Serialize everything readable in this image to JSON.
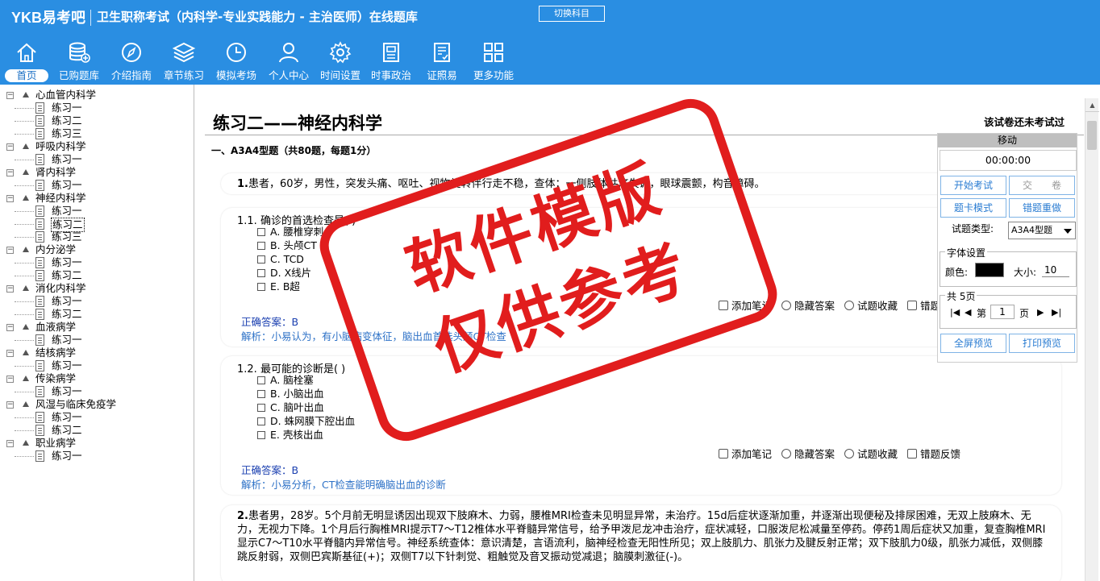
{
  "header": {
    "logo": "YKB易考吧",
    "app_title": "卫生职称考试（内科学-专业实践能力 - 主治医师）在线题库",
    "switch_label": "切换科目"
  },
  "nav": [
    {
      "label": "首页",
      "icon": "home-icon",
      "active": true
    },
    {
      "label": "已购题库",
      "icon": "database-icon"
    },
    {
      "label": "介绍指南",
      "icon": "compass-icon"
    },
    {
      "label": "章节练习",
      "icon": "layers-icon"
    },
    {
      "label": "模拟考场",
      "icon": "clock-icon"
    },
    {
      "label": "个人中心",
      "icon": "user-icon"
    },
    {
      "label": "时间设置",
      "icon": "gear-icon"
    },
    {
      "label": "时事政治",
      "icon": "news-icon"
    },
    {
      "label": "证照易",
      "icon": "certificate-icon"
    },
    {
      "label": "更多功能",
      "icon": "grid-icon"
    }
  ],
  "tree": [
    {
      "label": "心血管内科学",
      "children": [
        "练习一",
        "练习二",
        "练习三"
      ]
    },
    {
      "label": "呼吸内科学",
      "children": [
        "练习一"
      ]
    },
    {
      "label": "肾内科学",
      "children": [
        "练习一"
      ]
    },
    {
      "label": "神经内科学",
      "children": [
        "练习一",
        "练习二",
        "练习三"
      ]
    },
    {
      "label": "内分泌学",
      "children": [
        "练习一",
        "练习二"
      ]
    },
    {
      "label": "消化内科学",
      "children": [
        "练习一",
        "练习二"
      ]
    },
    {
      "label": "血液病学",
      "children": [
        "练习一"
      ]
    },
    {
      "label": "结核病学",
      "children": [
        "练习一"
      ]
    },
    {
      "label": "传染病学",
      "children": [
        "练习一"
      ]
    },
    {
      "label": "风湿与临床免疫学",
      "children": [
        "练习一",
        "练习二"
      ]
    },
    {
      "label": "职业病学",
      "children": [
        "练习一"
      ]
    }
  ],
  "main": {
    "page_title": "练习二——神经内科学",
    "exam_status": "该试卷还未考试过",
    "section_title": "一、A3A4型题（共80题，每题1分）",
    "q1_stem_num": "1.",
    "q1_stem": "患者，60岁，男性，突发头痛、呕吐、视物旋转伴行走不稳，查体：一侧肢体共济失调，眼球震颤，构音障碍。",
    "q11_title": "1.1. 确诊的首选检查是( )",
    "q11_options": [
      "A. 腰椎穿刺",
      "B. 头颅CT",
      "C. TCD",
      "D. X线片",
      "E. B超"
    ],
    "q11_answer": "正确答案：B",
    "q11_analysis": "解析：小易认为，有小脑病变体征，脑出血首选头颅CT检查",
    "q12_title": "1.2. 最可能的诊断是( )",
    "q12_options": [
      "A. 脑栓塞",
      "B. 小脑出血",
      "C. 脑叶出血",
      "D. 蛛网膜下腔出血",
      "E. 壳核出血"
    ],
    "q12_answer": "正确答案：B",
    "q12_analysis": "解析：小易分析，CT检查能明确脑出血的诊断",
    "q2_stem_num": "2.",
    "q2_stem": "患者男，28岁。5个月前无明显诱因出现双下肢麻木、力弱，腰椎MRI检查未见明显异常，未治疗。15d后症状逐渐加重，并逐渐出现便秘及排尿困难，无双上肢麻木、无力，无视力下降。1个月后行胸椎MRI提示T7～T12椎体水平脊髓异常信号，给予甲泼尼龙冲击治疗，症状减轻，口服泼尼松减量至停药。停药1周后症状又加重，复查胸椎MRI显示C7～T10水平脊髓内异常信号。神经系统查体：意识清楚，言语流利，脑神经检查无阳性所见；双上肢肌力、肌张力及腱反射正常；双下肢肌力0级，肌张力减低，双侧膝跳反射弱，双侧巴宾斯基征(+)；双侧T7以下针刺觉、粗触觉及音叉振动觉减退；脑膜刺激征(-)。",
    "tools": [
      "添加笔记",
      "隐藏答案",
      "试题收藏",
      "错题反馈"
    ]
  },
  "panel": {
    "header": "移动",
    "timer": "00:00:00",
    "start_exam": "开始考试",
    "submit": "交　　卷",
    "card_mode": "题卡模式",
    "redo_wrong": "错题重做",
    "qtype_label": "试题类型:",
    "qtype_value": "A3A4型题",
    "font_legend": "字体设置",
    "color_label": "颜色:",
    "color_value": "#000000",
    "size_label": "大小:",
    "size_value": "10",
    "pages_legend": "共 5页",
    "page_prefix": "第",
    "page_value": "1",
    "page_suffix": "页",
    "fullscreen": "全屏预览",
    "print": "打印预览"
  },
  "stamp": {
    "line1": "软件模版",
    "line2": "仅供参考"
  },
  "colors": {
    "topbar": "#2a8ee2",
    "stamp": "#e11d1d",
    "answer": "#1a3fb0",
    "analysis": "#2e72c7"
  }
}
